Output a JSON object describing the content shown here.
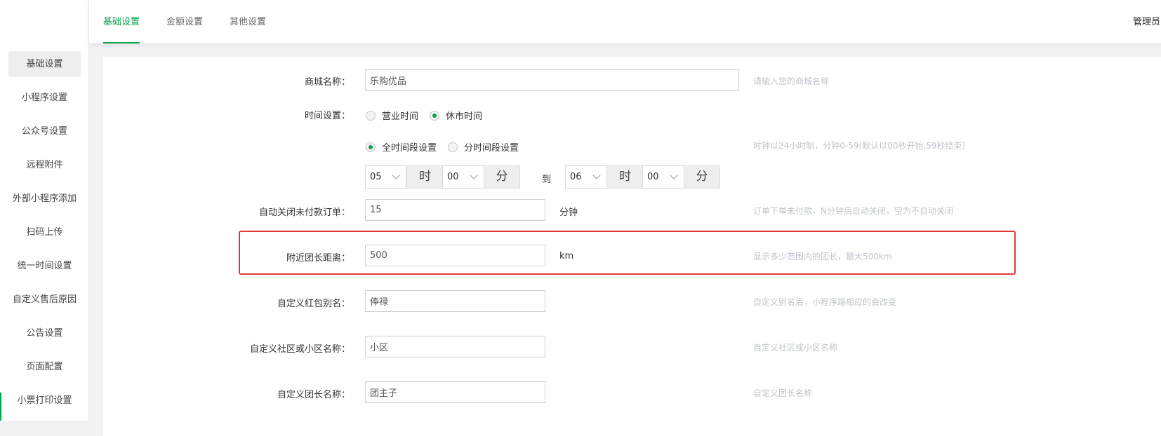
{
  "sidebar": {
    "items": [
      {
        "label": "基础设置"
      },
      {
        "label": "小程序设置"
      },
      {
        "label": "公众号设置"
      },
      {
        "label": "远程附件"
      },
      {
        "label": "外部小程序添加"
      },
      {
        "label": "扫码上传"
      },
      {
        "label": "统一时间设置"
      },
      {
        "label": "自定义售后原因"
      },
      {
        "label": "公告设置"
      },
      {
        "label": "页面配置"
      },
      {
        "label": "小票打印设置"
      }
    ]
  },
  "topbar": {
    "tabs": [
      {
        "label": "基础设置"
      },
      {
        "label": "金额设置"
      },
      {
        "label": "其他设置"
      }
    ],
    "admin": "管理员"
  },
  "form": {
    "shop_name": {
      "label": "商城名称：",
      "value": "乐购优品",
      "hint": "请输入您的商城名称"
    },
    "time": {
      "label": "时间设置：",
      "mode_options": [
        "营业时间",
        "休市时间"
      ],
      "range_options": [
        "全时间段设置",
        "分时间段设置"
      ],
      "hint": "时钟以24小时制，分钟0-59(默认以00秒开始,59秒结束)",
      "start_hour": "05",
      "start_minute": "00",
      "end_hour": "06",
      "end_minute": "00",
      "hour_unit": "时",
      "minute_unit": "分",
      "to": "到"
    },
    "auto_close": {
      "label": "自动关闭未付款订单：",
      "value": "15",
      "unit": "分钟",
      "hint": "订单下单未付款，N分钟后自动关闭，空为不自动关闭"
    },
    "nearby": {
      "label": "附近团长距离：",
      "value": "500",
      "unit": "km",
      "hint": "显示多少范围内的团长，最大500km"
    },
    "redpacket": {
      "label": "自定义红包别名：",
      "value": "俸禄",
      "hint": "自定义别名后，小程序端相应的会改变"
    },
    "community": {
      "label": "自定义社区或小区名称：",
      "value": "小区",
      "hint": "自定义社区或小区名称"
    },
    "leader": {
      "label": "自定义团长名称：",
      "value": "团主子",
      "hint": "自定义团长名称"
    }
  }
}
